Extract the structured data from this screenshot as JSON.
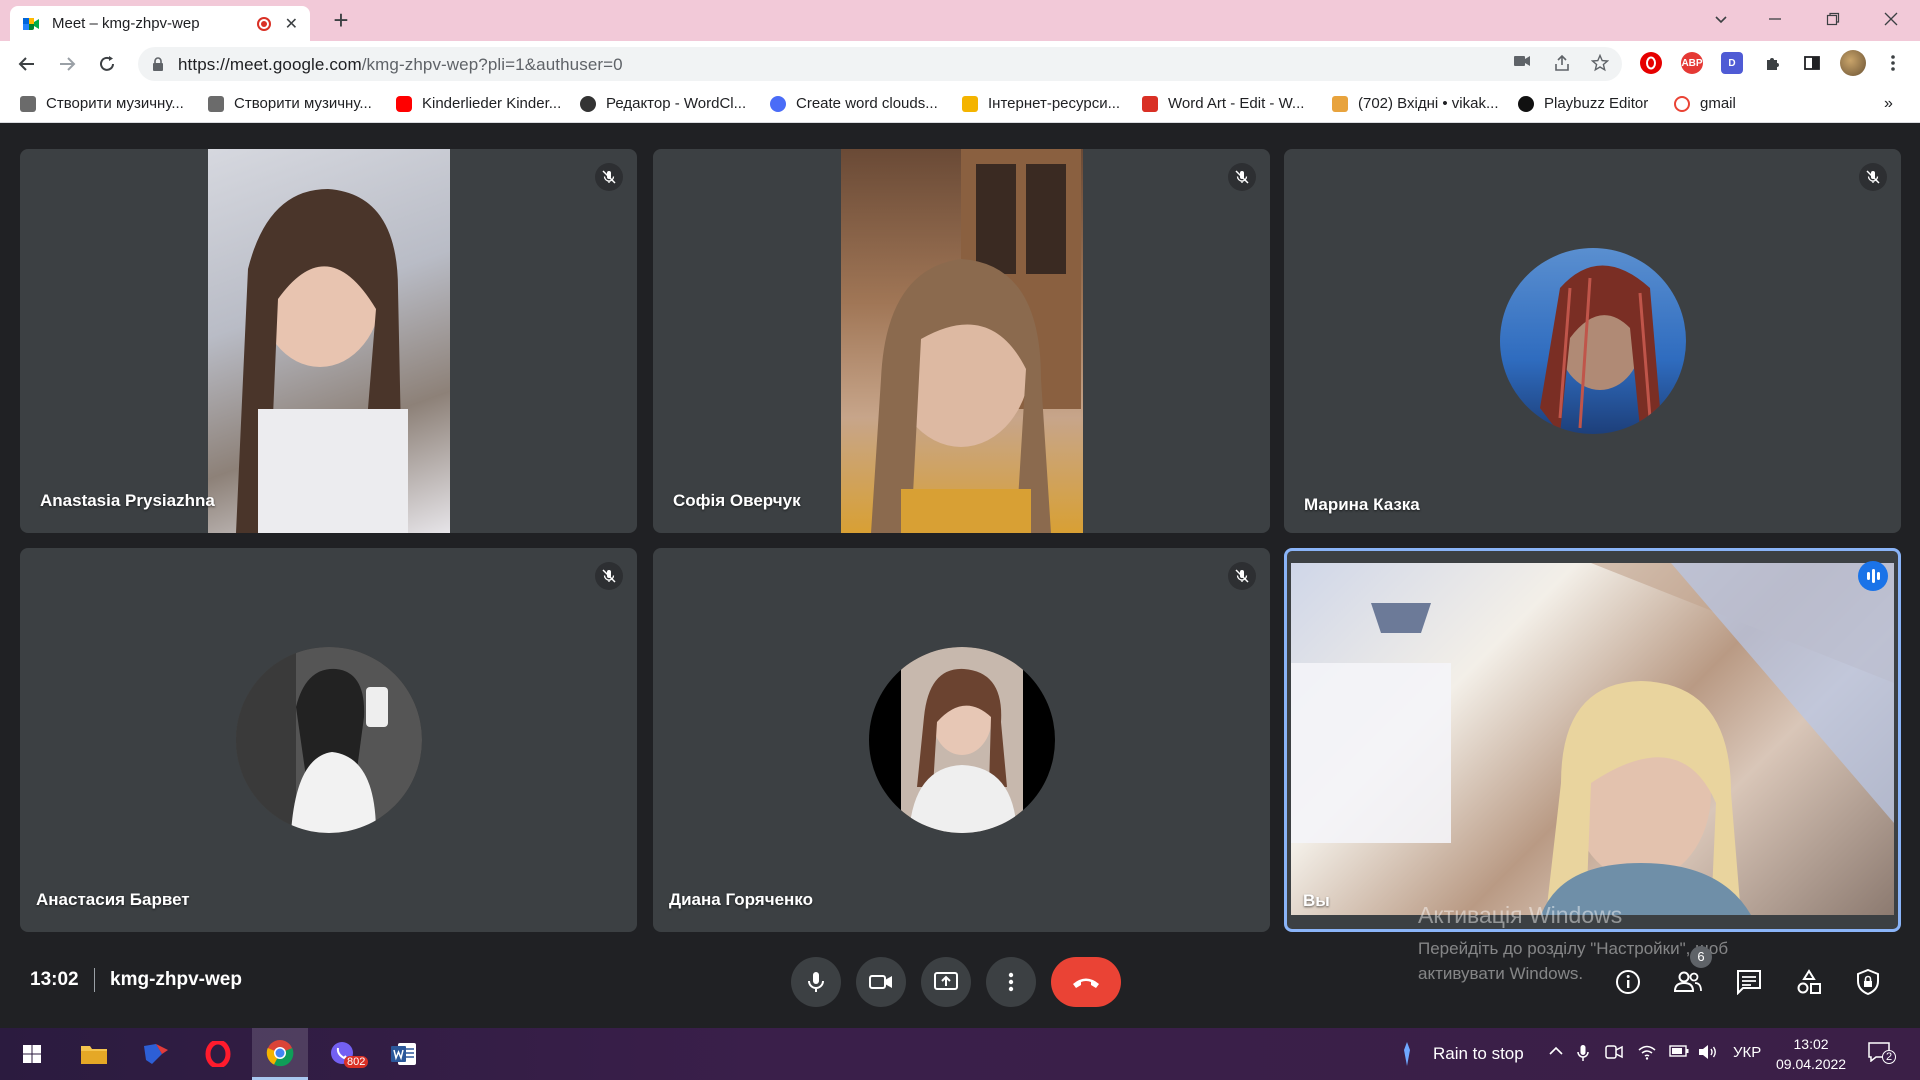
{
  "browser": {
    "tab_title": "Meet – kmg-zhpv-wep",
    "tab_close": "✕",
    "new_tab": "+",
    "url_host": "https://meet.google.com",
    "url_path": "/kmg-zhpv-wep?pli=1&authuser=0",
    "ext_abp": "ABP",
    "ext_d": "D",
    "bookmarks": [
      {
        "label": "Створити музичну...",
        "color": "#6b6b6b"
      },
      {
        "label": "Створити музичну...",
        "color": "#6b6b6b"
      },
      {
        "label": "Kinderlieder Kinder...",
        "color": "#ff0000"
      },
      {
        "label": "Редактор - WordCl...",
        "color": "#333333"
      },
      {
        "label": "Create word clouds...",
        "color": "#4a6cf7"
      },
      {
        "label": "Інтернет-ресурси...",
        "color": "#f4b400"
      },
      {
        "label": "Word Art - Edit - W...",
        "color": "#d93025"
      },
      {
        "label": "(702) Вхідні • vikak...",
        "color": "#e8a33d"
      },
      {
        "label": "Playbuzz Editor",
        "color": "#111111"
      },
      {
        "label": "gmail",
        "color": "#ea4335"
      }
    ],
    "more_bookmarks": "»"
  },
  "meet": {
    "participants": [
      {
        "name": "Anastasia Prysiazhna",
        "muted": true
      },
      {
        "name": "Софія Оверчук",
        "muted": true
      },
      {
        "name": "Марина Казка",
        "muted": true
      },
      {
        "name": "Анастасия Барвет",
        "muted": true
      },
      {
        "name": "Диана Горяченко",
        "muted": true
      },
      {
        "name": "Вы",
        "muted": false,
        "speaking": true
      }
    ],
    "time": "13:02",
    "meeting_code": "kmg-zhpv-wep",
    "people_count": "6",
    "accent_color": "#8ab4f8",
    "end_call_color": "#ea4335"
  },
  "watermark": {
    "title": "Активація Windows",
    "subtitle": "Перейдіть до розділу \"Настройки\", щоб активувати Windows."
  },
  "taskbar": {
    "viber_badge": "802",
    "weather": "Rain to stop",
    "language": "УКР",
    "clock_time": "13:02",
    "clock_date": "09.04.2022",
    "notifications": "2"
  }
}
